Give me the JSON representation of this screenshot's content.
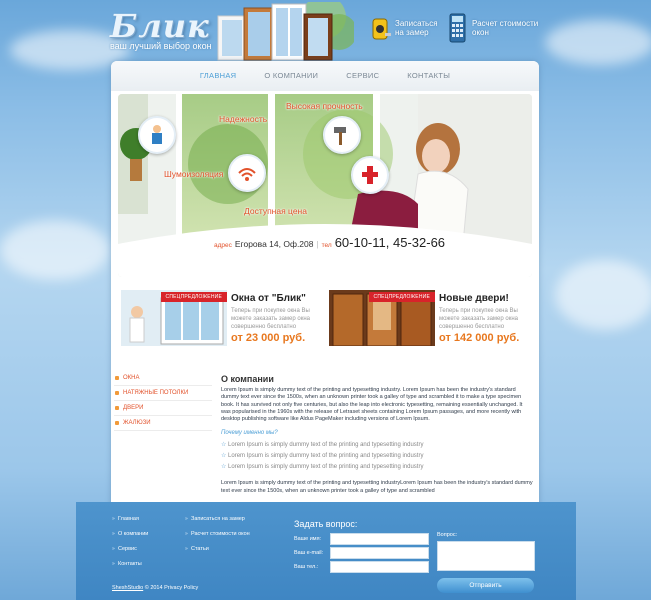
{
  "header": {
    "logo_text": "Блик",
    "tagline": "ваш лучший выбор окон",
    "measure_link": "Записаться на замер",
    "calc_link": "Расчет стоимости окон"
  },
  "nav": {
    "items": [
      {
        "label": "ГЛАВНАЯ",
        "active": true
      },
      {
        "label": "О КОМПАНИИ",
        "active": false
      },
      {
        "label": "СЕРВИС",
        "active": false
      },
      {
        "label": "КОНТАКТЫ",
        "active": false
      }
    ]
  },
  "banner": {
    "features": [
      "Высокая прочность",
      "Надежность",
      "Шумоизоляция",
      "Доступная цена"
    ],
    "address_label": "адрес",
    "address": "Егорова 14, Оф.208",
    "phone_label": "тел",
    "phone": "60-10-11, 45-32-66"
  },
  "promos": [
    {
      "ribbon": "СПЕЦПРЕДЛОЖЕНИЕ",
      "title": "Окна от \"Блик\"",
      "text": "Теперь при покупке окна Вы можете заказать замер окна совершенно бесплатно",
      "price": "от 23 000 руб."
    },
    {
      "ribbon": "СПЕЦПРЕДЛОЖЕНИЕ",
      "title": "Новые двери!",
      "text": "Теперь при покупке окна Вы можете заказать замер окна совершенно бесплатно",
      "price": "от 142 000 руб."
    }
  ],
  "sidebar": {
    "items": [
      "ОКНА",
      "НАТЯЖНЫЕ ПОТОЛКИ",
      "ДВЕРИ",
      "ЖАЛЮЗИ"
    ]
  },
  "content": {
    "title": "О компании",
    "para1": "Lorem Ipsum is simply dummy text of the printing and typesetting industry. Lorem Ipsum has been the industry's standard dummy text ever since the 1500s, when an unknown printer took a galley of type and scrambled it to make a type specimen book. It has survived not only five centuries, but also the leap into electronic typesetting, remaining essentially unchanged. It was popularised in the 1960s with the release of Letraset sheets containing Lorem Ipsum passages, and more recently with desktop publishing software like Aldus PageMaker including versions of Lorem Ipsum.",
    "why": "Почему именно мы?",
    "bullets": [
      "Lorem Ipsum is simply dummy text of the printing and typesetting industry",
      "Lorem Ipsum is simply dummy text of the printing and typesetting industry",
      "Lorem Ipsum is simply dummy text of the printing and typesetting industry"
    ],
    "para2": "Lorem Ipsum is simply dummy text of the printing and typesetting industryLorem Ipsum has been the industry's standard dummy text ever since the 1500s, when an unknown printer took a galley of type and scrambled"
  },
  "footer": {
    "col1": [
      "Главная",
      "О компании",
      "Сервис",
      "Контакты"
    ],
    "col2": [
      "Записаться на замер",
      "Расчет стоимости окон",
      "Статьи"
    ],
    "ask_title": "Задать вопрос:",
    "name_label": "Ваше имя:",
    "email_label": "Ваш e-mail:",
    "phone_label": "Ваш тел.:",
    "question_label": "Вопрос:",
    "send_label": "Отправить",
    "studio": "SheshStudio",
    "copyright": "© 2014 Privacy Policy"
  },
  "colors": {
    "accent": "#4d9fd6",
    "orange": "#e2522b",
    "price": "#e8781f",
    "ribbon": "#d8232a"
  }
}
